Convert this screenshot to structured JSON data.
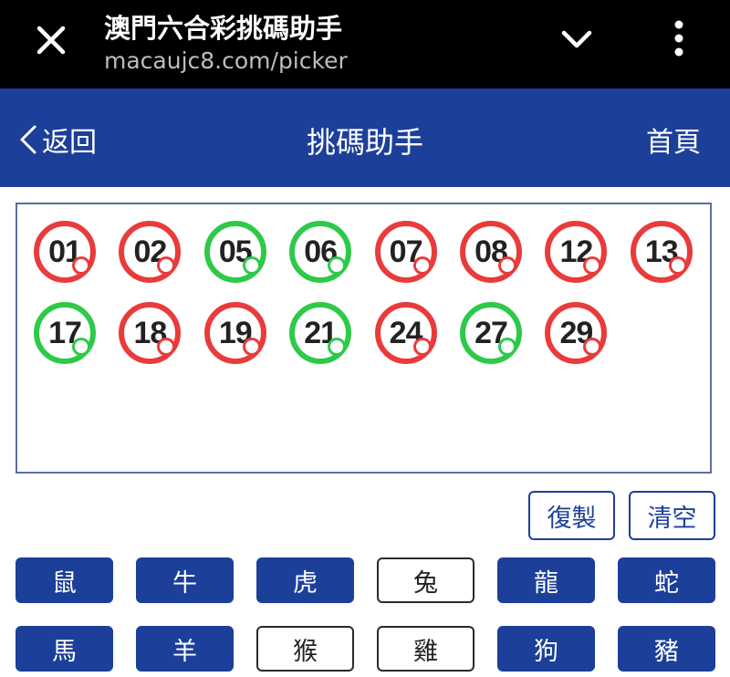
{
  "browser": {
    "title": "澳門六合彩挑碼助手",
    "url": "macaujc8.com/picker",
    "close_icon": "close-icon",
    "expand_icon": "chevron-down-icon",
    "menu_icon": "more-vertical-icon"
  },
  "header": {
    "back_label": "返回",
    "title": "挑碼助手",
    "home_label": "首頁",
    "color": "#1c3f9a"
  },
  "colors": {
    "red": "#e93b3b",
    "green": "#2fc94a",
    "accent": "#1c3f9a"
  },
  "selected_numbers": [
    {
      "num": "01",
      "color": "red"
    },
    {
      "num": "02",
      "color": "red"
    },
    {
      "num": "05",
      "color": "green"
    },
    {
      "num": "06",
      "color": "green"
    },
    {
      "num": "07",
      "color": "red"
    },
    {
      "num": "08",
      "color": "red"
    },
    {
      "num": "12",
      "color": "red"
    },
    {
      "num": "13",
      "color": "red"
    },
    {
      "num": "17",
      "color": "green"
    },
    {
      "num": "18",
      "color": "red"
    },
    {
      "num": "19",
      "color": "red"
    },
    {
      "num": "21",
      "color": "green"
    },
    {
      "num": "24",
      "color": "red"
    },
    {
      "num": "27",
      "color": "green"
    },
    {
      "num": "29",
      "color": "red"
    }
  ],
  "actions": {
    "copy_label": "復製",
    "clear_label": "清空"
  },
  "zodiac": [
    {
      "label": "鼠",
      "selected": true
    },
    {
      "label": "牛",
      "selected": true
    },
    {
      "label": "虎",
      "selected": true
    },
    {
      "label": "兔",
      "selected": false
    },
    {
      "label": "龍",
      "selected": true
    },
    {
      "label": "蛇",
      "selected": true
    },
    {
      "label": "馬",
      "selected": true
    },
    {
      "label": "羊",
      "selected": true
    },
    {
      "label": "猴",
      "selected": false
    },
    {
      "label": "雞",
      "selected": false
    },
    {
      "label": "狗",
      "selected": true
    },
    {
      "label": "豬",
      "selected": true
    }
  ]
}
